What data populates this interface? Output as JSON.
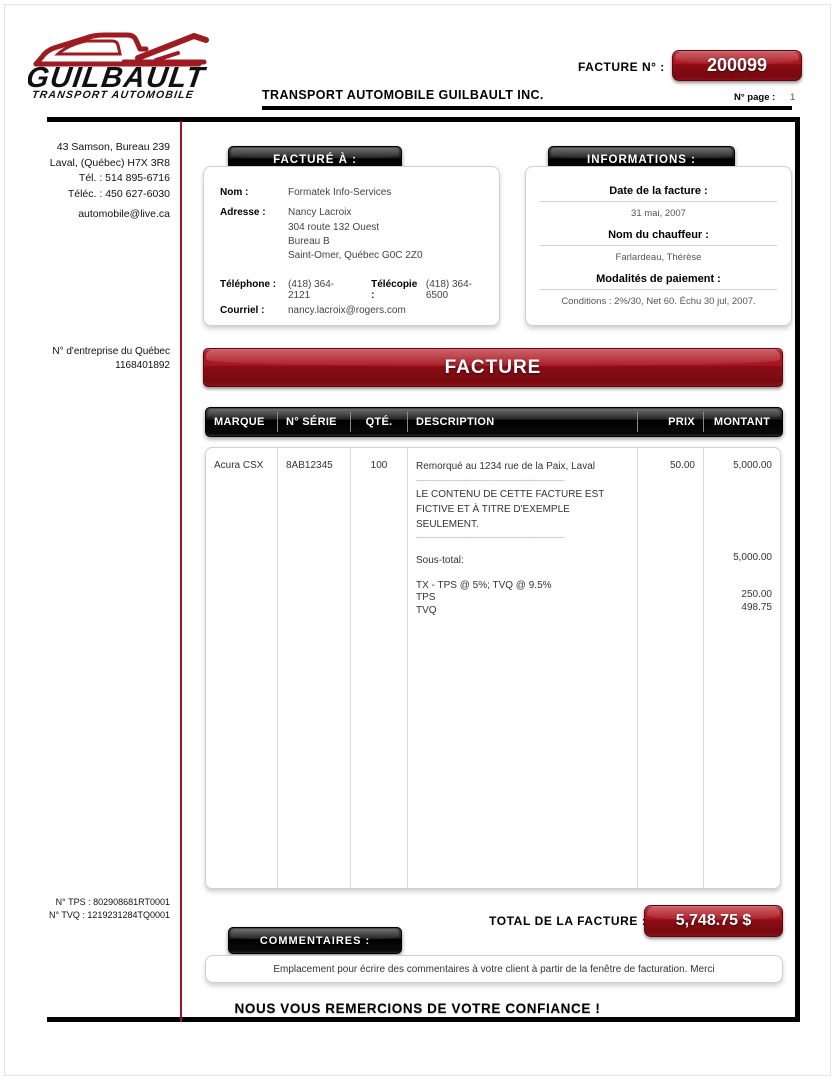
{
  "header": {
    "logo_word": "GUILBAULT",
    "logo_tagline": "TRANSPORT AUTOMOBILE",
    "company_name": "TRANSPORT AUTOMOBILE GUILBAULT INC.",
    "invoice_no_label": "FACTURE N° :",
    "invoice_no": "200099",
    "page_label": "N° page :",
    "page_value": "1"
  },
  "sender": {
    "address_line1": "43 Samson, Bureau 239",
    "address_line2": "Laval, (Québec)  H7X 3R8",
    "phone": "Tél. : 514 895-6716",
    "fax": "Téléc. : 450 627-6030",
    "email": "automobile@live.ca",
    "qc_enterprise_label": "N° d'entreprise du Québec",
    "qc_enterprise_no": "1168401892",
    "tps_no": "N° TPS : 802908681RT0001",
    "tvq_no": "N° TVQ : 1219231284TQ0001"
  },
  "bill_to": {
    "title": "FACTURÉ À :",
    "name_label": "Nom :",
    "name_value": "Formatek Info-Services",
    "address_label": "Adresse :",
    "address_line1": "Nancy Lacroix",
    "address_line2": "304 route 132 Ouest",
    "address_line3": "Bureau B",
    "address_line4": "Saint-Omer, Québec  G0C 2Z0",
    "phone_label": "Téléphone :",
    "phone_value": "(418) 364-2121",
    "fax_label": "Télécopie :",
    "fax_value": "(418) 364-6500",
    "email_label": "Courriel :",
    "email_value": "nancy.lacroix@rogers.com"
  },
  "informations": {
    "title": "INFORMATIONS :",
    "date_label": "Date de la facture :",
    "date_value": "31 mai, 2007",
    "driver_label": "Nom du chauffeur :",
    "driver_value": "Farlardeau, Thérèse",
    "terms_label": "Modalités de paiement :",
    "terms_value": "Conditions : 2%/30, Net 60. Échu 30 jul, 2007."
  },
  "banner": {
    "title": "FACTURE"
  },
  "table": {
    "columns": [
      "MARQUE",
      "N° SÉRIE",
      "QTÉ.",
      "DESCRIPTION",
      "PRIX",
      "MONTANT"
    ],
    "row": {
      "marque": "Acura CSX",
      "serie": "8AB12345",
      "qte": "100",
      "description": "Remorqué au 1234 rue de la Paix, Laval",
      "separator": "-----------------------------------------------------",
      "note_line1": "LE CONTENU DE CETTE FACTURE EST",
      "note_line2": "FICTIVE ET À TITRE D'EXEMPLE",
      "note_line3": "SEULEMENT.",
      "subtotal_label": "Sous-total:",
      "tax_header": "TX - TPS @ 5%; TVQ @ 9.5%",
      "tps_label": "TPS",
      "tvq_label": "TVQ",
      "prix": "50.00",
      "montant": "5,000.00",
      "subtotal_amount": "5,000.00",
      "tps_amount": "250.00",
      "tvq_amount": "498.75"
    }
  },
  "totals": {
    "label": "TOTAL DE LA FACTURE :",
    "value": "5,748.75  $"
  },
  "comments": {
    "title": "COMMENTAIRES :",
    "placeholder_text": "Emplacement pour écrire des commentaires à votre client à partir de la fenêtre de facturation. Merci"
  },
  "footer": {
    "thanks": "NOUS VOUS REMERCIONS DE VOTRE CONFIANCE !"
  },
  "colors": {
    "red_light": "#b51b24",
    "red_dark": "#780a10",
    "divider_red": "#9c1420",
    "frame_black": "#000000"
  }
}
